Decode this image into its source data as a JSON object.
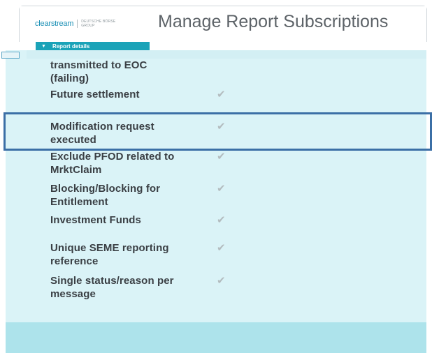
{
  "header": {
    "logo_text": "clearstream",
    "logo_group_line1": "DEUTSCHE BÖRSE",
    "logo_group_line2": "GROUP",
    "title": "Manage Report Subscriptions"
  },
  "section": {
    "label": "Report details",
    "expanded": true
  },
  "rows": [
    {
      "label_line1": "transmitted to EOC",
      "label_line2": "(failing)",
      "checked": false
    },
    {
      "label_line1": "Future settlement",
      "label_line2": "",
      "checked": true
    },
    {
      "label_line1": "Modification request",
      "label_line2": "executed",
      "checked": true,
      "highlighted": true
    },
    {
      "label_line1": "Exclude PFOD related to",
      "label_line2": "MrktClaim",
      "checked": true
    },
    {
      "label_line1": "Blocking/Blocking for",
      "label_line2": "Entitlement",
      "checked": true
    },
    {
      "label_line1": "Investment Funds",
      "label_line2": "",
      "checked": true
    },
    {
      "label_line1": "Unique SEME reporting",
      "label_line2": "reference",
      "checked": true
    },
    {
      "label_line1": "Single status/reason per",
      "label_line2": "message",
      "checked": true
    }
  ],
  "colors": {
    "accent": "#1ba3b8",
    "content_bg": "#daf3f7",
    "highlight_border": "#3b6fa6"
  }
}
